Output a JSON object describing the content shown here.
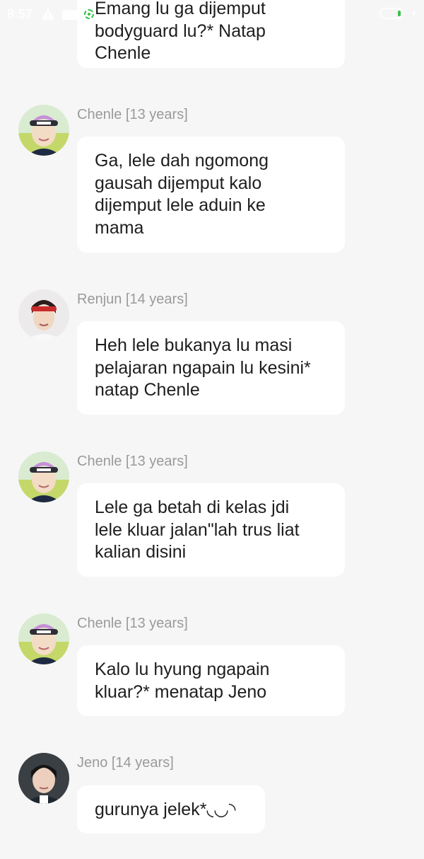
{
  "status_bar": {
    "time": "8:57",
    "icons": [
      "warning-icon",
      "youtube-icon",
      "notification-dot-icon",
      "battery-icon"
    ]
  },
  "messages": [
    {
      "sender": "",
      "text_lines": [
        "Emang lu ga dijemput",
        "bodyguard lu?* Natap",
        "Chenle"
      ],
      "avatar": ""
    },
    {
      "sender": "Chenle [13 years]",
      "text_lines": [
        "Ga, lele dah ngomong",
        "gausah dijemput kalo",
        "dijemput lele aduin ke",
        "mama"
      ],
      "avatar": "chenle-avatar"
    },
    {
      "sender": "Renjun [14 years]",
      "text_lines": [
        "Heh lele bukanya lu masi",
        "pelajaran ngapain lu kesini*",
        "natap Chenle"
      ],
      "avatar": "renjun-avatar"
    },
    {
      "sender": "Chenle [13 years]",
      "text_lines": [
        "Lele ga betah di kelas jdi",
        "lele kluar jalan\"lah trus liat",
        "kalian disini"
      ],
      "avatar": "chenle-avatar"
    },
    {
      "sender": "Chenle [13 years]",
      "text_lines": [
        "Kalo lu hyung ngapain",
        "kluar?* menatap Jeno"
      ],
      "avatar": "chenle-avatar"
    },
    {
      "sender": "Jeno [14 years]",
      "text_lines": [
        "gurunya jelek*◟◡◝"
      ],
      "avatar": "jeno-avatar"
    }
  ],
  "colors": {
    "background": "#f6f6f6",
    "bubble": "#ffffff",
    "sender_text": "#9a9a9a",
    "message_text": "#1e1e1e"
  }
}
